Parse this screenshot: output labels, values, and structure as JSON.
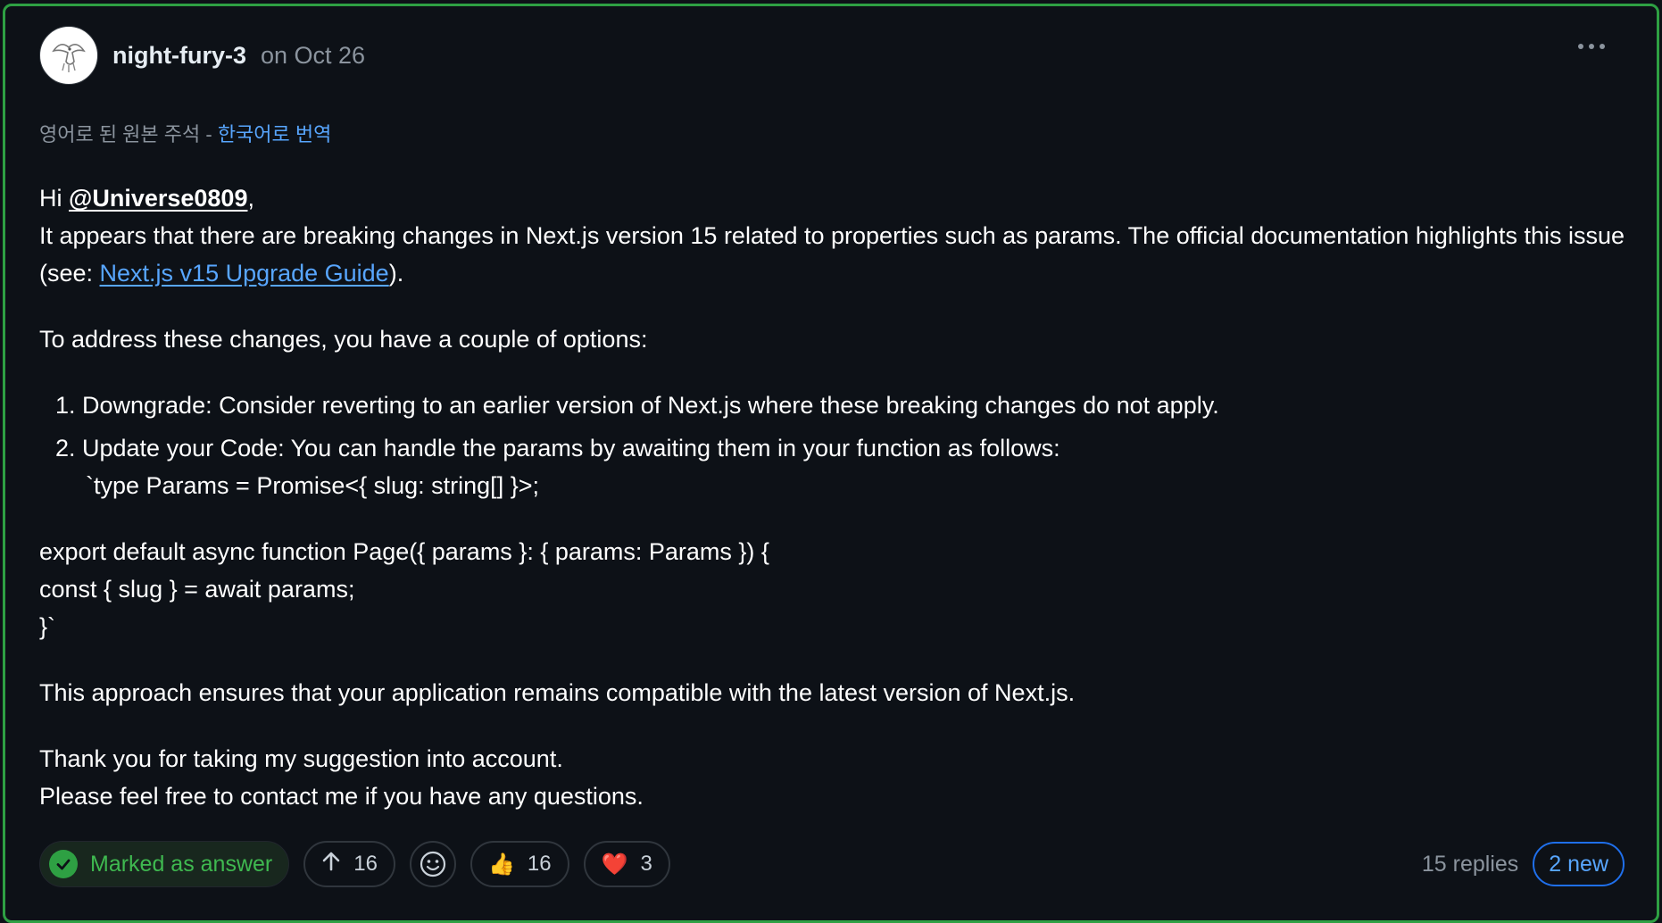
{
  "comment": {
    "author": "night-fury-3",
    "date": "on Oct 26",
    "translation": {
      "original_note": "영어로 된 원본 주석 - ",
      "translate_link": "한국어로 번역"
    },
    "body": {
      "greeting_prefix": "Hi ",
      "mention": "@Universe0809",
      "greeting_suffix": ",",
      "intro_text": "It appears that there are breaking changes in Next.js version 15 related to properties such as params. The official documentation highlights this issue (see: ",
      "guide_link": "Next.js v15 Upgrade Guide",
      "intro_end": ").",
      "options_intro": "To address these changes, you have a couple of options:",
      "options": [
        "Downgrade: Consider reverting to an earlier version of Next.js where these breaking changes do not apply.",
        "Update your Code: You can handle the params by awaiting them in your function as follows:"
      ],
      "code_line_0": "`type Params = Promise<{ slug: string[] }>;",
      "code_lines": [
        "export default async function Page({ params }: { params: Params }) {",
        "const { slug } = await params;",
        "}`"
      ],
      "conclusion": "This approach ensures that your application remains compatible with the latest version of Next.js.",
      "thanks": "Thank you for taking my suggestion into account.",
      "contact": "Please feel free to contact me if you have any questions."
    },
    "footer": {
      "answer_label": "Marked as answer",
      "upvotes": "16",
      "reactions": [
        {
          "emoji": "👍",
          "count": "16"
        },
        {
          "emoji": "❤️",
          "count": "3"
        }
      ],
      "replies": "15 replies",
      "new_count": "2 new"
    }
  },
  "colors": {
    "accent_green": "#2ea043",
    "link_blue": "#58a6ff",
    "background": "#0d1117"
  }
}
